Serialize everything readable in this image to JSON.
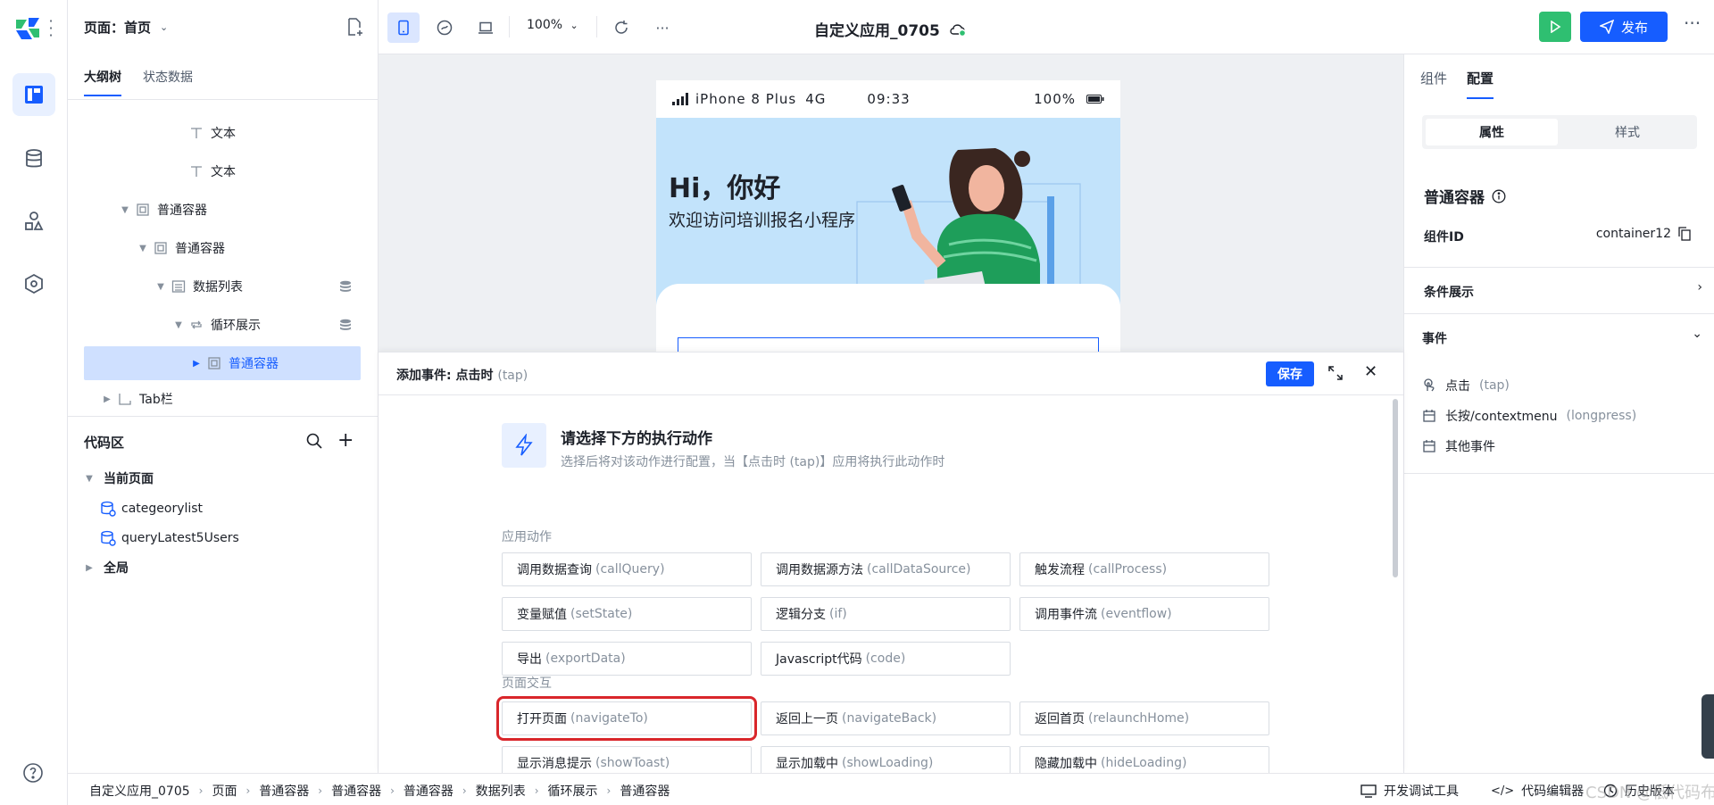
{
  "page_selector": {
    "label": "页面：首页"
  },
  "outline_tabs": [
    "大纲树",
    "状态数据"
  ],
  "tree": [
    {
      "label": "文本",
      "icon": "text-icon",
      "indent": 5,
      "toggle": ""
    },
    {
      "label": "文本",
      "icon": "text-icon",
      "indent": 5,
      "toggle": ""
    },
    {
      "label": "普通容器",
      "icon": "container-icon",
      "indent": 2,
      "toggle": "▼"
    },
    {
      "label": "普通容器",
      "icon": "container-icon",
      "indent": 3,
      "toggle": "▼"
    },
    {
      "label": "数据列表",
      "icon": "list-icon",
      "indent": 4,
      "toggle": "▼",
      "db": true
    },
    {
      "label": "循环展示",
      "icon": "loop-icon",
      "indent": 5,
      "toggle": "▼",
      "db": true
    },
    {
      "label": "普通容器",
      "icon": "container-icon",
      "indent": 6,
      "toggle": "▶",
      "selected": true
    },
    {
      "label": "Tab栏",
      "icon": "tabbar-icon",
      "indent": 1,
      "toggle": "▶"
    }
  ],
  "code_area": {
    "title": "代码区",
    "current_page": "当前页面",
    "items": [
      "categeorylist",
      "queryLatest5Users"
    ],
    "global": "全局"
  },
  "toolbar": {
    "zoom": "100%",
    "app_title": "自定义应用_0705",
    "publish": "发布"
  },
  "preview": {
    "device": "iPhone 8 Plus",
    "network": "4G",
    "time": "09:33",
    "battery": "100%",
    "greeting": "Hi，你好",
    "welcome": "欢迎访问培训报名小程序"
  },
  "config": {
    "tabs": [
      "组件",
      "配置"
    ],
    "segments": [
      "属性",
      "样式"
    ],
    "component_name": "普通容器",
    "id_label": "组件ID",
    "id_value": "container12",
    "condition_label": "条件展示",
    "events_label": "事件",
    "events": [
      {
        "cn": "点击",
        "en": "(tap)"
      },
      {
        "cn": "长按/contextmenu",
        "en": "(longpress)"
      },
      {
        "cn": "其他事件",
        "en": ""
      }
    ]
  },
  "dialog": {
    "title": "添加事件: 点击时",
    "title_en": "(tap)",
    "save": "保存",
    "hint_title": "请选择下方的执行动作",
    "hint_sub": "选择后将对该动作进行配置，当【点击时 (tap)】应用将执行此动作时",
    "groups": [
      {
        "label": "应用动作",
        "actions": [
          {
            "cn": "调用数据查询",
            "en": "(callQuery)"
          },
          {
            "cn": "调用数据源方法",
            "en": "(callDataSource)"
          },
          {
            "cn": "触发流程",
            "en": "(callProcess)"
          },
          {
            "cn": "变量赋值",
            "en": "(setState)"
          },
          {
            "cn": "逻辑分支",
            "en": "(if)"
          },
          {
            "cn": "调用事件流",
            "en": "(eventflow)"
          },
          {
            "cn": "导出",
            "en": "(exportData)"
          },
          {
            "cn": "Javascript代码",
            "en": "(code)"
          }
        ]
      },
      {
        "label": "页面交互",
        "actions": [
          {
            "cn": "打开页面",
            "en": "(navigateTo)",
            "highlight": true
          },
          {
            "cn": "返回上一页",
            "en": "(navigateBack)"
          },
          {
            "cn": "返回首页",
            "en": "(relaunchHome)"
          },
          {
            "cn": "显示消息提示",
            "en": "(showToast)"
          },
          {
            "cn": "显示加载中",
            "en": "(showLoading)"
          },
          {
            "cn": "隐藏加载中",
            "en": "(hideLoading)"
          }
        ]
      }
    ]
  },
  "breadcrumb": [
    "自定义应用_0705",
    "页面",
    "普通容器",
    "普通容器",
    "普通容器",
    "数据列表",
    "循环展示",
    "普通容器"
  ],
  "bottom_tools": [
    "开发调试工具",
    "代码编辑器",
    "历史版本"
  ],
  "watermark": "CSDN @低代码布道师",
  "colors": {
    "primary": "#165dff",
    "run": "#2fbf71",
    "highlight": "#d9262b",
    "banner": "#c2e3fb"
  }
}
